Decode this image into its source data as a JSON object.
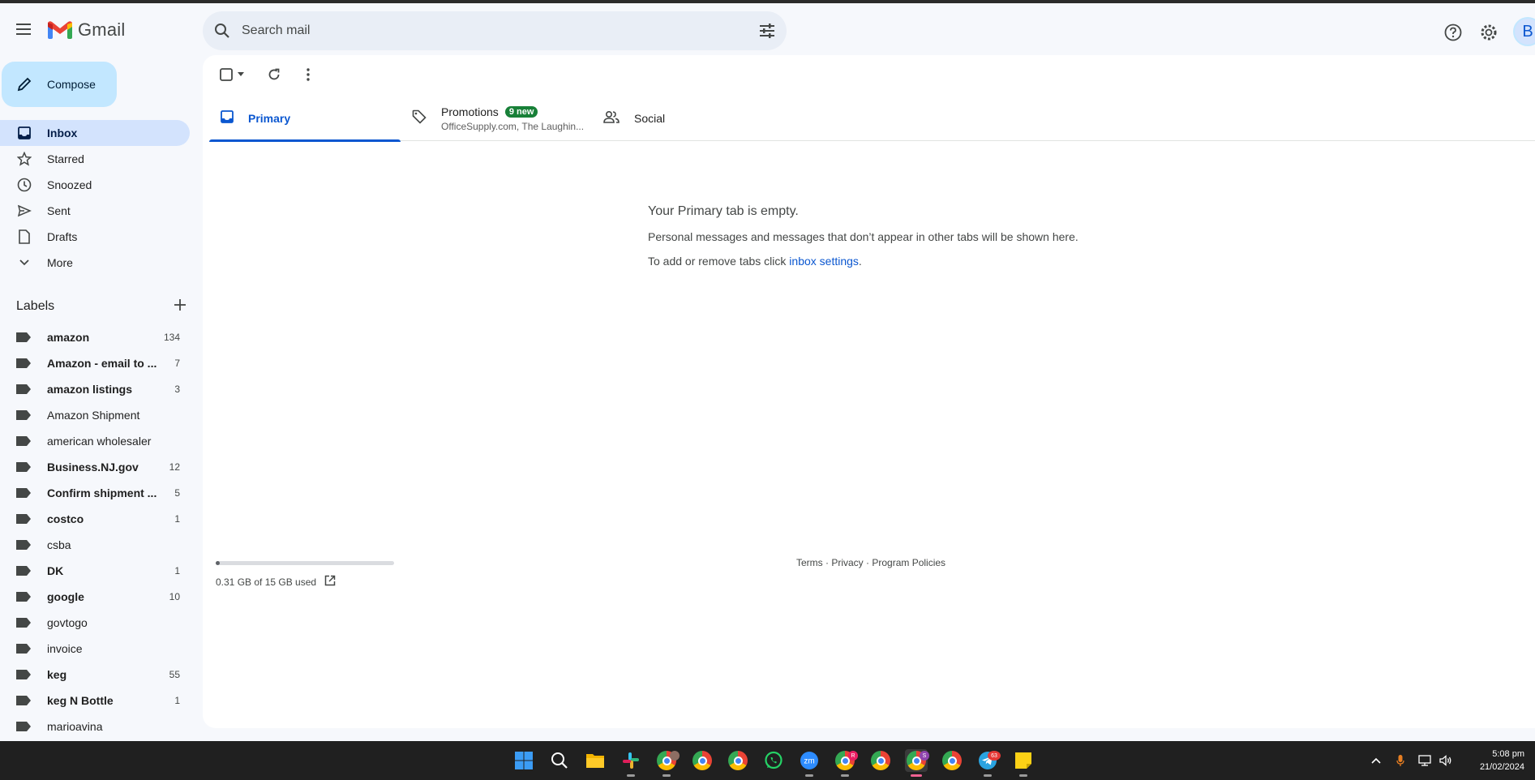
{
  "app": {
    "name": "Gmail"
  },
  "search": {
    "placeholder": "Search mail"
  },
  "compose": {
    "label": "Compose"
  },
  "nav": [
    {
      "label": "Inbox",
      "icon": "inbox-icon",
      "active": true
    },
    {
      "label": "Starred",
      "icon": "star-icon",
      "active": false
    },
    {
      "label": "Snoozed",
      "icon": "clock-icon",
      "active": false
    },
    {
      "label": "Sent",
      "icon": "send-icon",
      "active": false
    },
    {
      "label": "Drafts",
      "icon": "draft-icon",
      "active": false
    },
    {
      "label": "More",
      "icon": "chevron-down-icon",
      "active": false
    }
  ],
  "labels_header": "Labels",
  "labels": [
    {
      "name": "amazon",
      "count": "134",
      "bold": true
    },
    {
      "name": "Amazon - email to ...",
      "count": "7",
      "bold": true
    },
    {
      "name": "amazon listings",
      "count": "3",
      "bold": true
    },
    {
      "name": "Amazon Shipment",
      "count": "",
      "bold": false
    },
    {
      "name": "american wholesaler",
      "count": "",
      "bold": false
    },
    {
      "name": "Business.NJ.gov",
      "count": "12",
      "bold": true
    },
    {
      "name": "Confirm shipment ...",
      "count": "5",
      "bold": true
    },
    {
      "name": "costco",
      "count": "1",
      "bold": true
    },
    {
      "name": "csba",
      "count": "",
      "bold": false
    },
    {
      "name": "DK",
      "count": "1",
      "bold": true
    },
    {
      "name": "google",
      "count": "10",
      "bold": true
    },
    {
      "name": "govtogo",
      "count": "",
      "bold": false
    },
    {
      "name": "invoice",
      "count": "",
      "bold": false
    },
    {
      "name": "keg",
      "count": "55",
      "bold": true
    },
    {
      "name": "keg N Bottle",
      "count": "1",
      "bold": true
    },
    {
      "name": "marioavina",
      "count": "",
      "bold": false
    }
  ],
  "tabs": {
    "primary": "Primary",
    "promotions": "Promotions",
    "promotions_badge": "9 new",
    "promotions_sub": "OfficeSupply.com, The Laughin...",
    "social": "Social"
  },
  "empty_state": {
    "title": "Your Primary tab is empty.",
    "line1": "Personal messages and messages that don’t appear in other tabs will be shown here.",
    "line2_prefix": "To add or remove tabs click ",
    "line2_link": "inbox settings",
    "line2_suffix": "."
  },
  "storage": {
    "text": "0.31 GB of 15 GB used",
    "used_fraction": 0.021
  },
  "footer": {
    "terms": "Terms",
    "sep": " · ",
    "privacy": "Privacy",
    "policies": "Program Policies"
  },
  "avatar": {
    "initial": "B"
  },
  "taskbar": {
    "badges": {
      "chrome_r": "R",
      "chrome_s": "S",
      "telegram": "63"
    },
    "time": "5:08 pm",
    "date": "21/02/2024"
  },
  "colors": {
    "accent": "#0b57d0",
    "compose_bg": "#c2e7ff",
    "active_nav": "#d3e3fd",
    "badge_green": "#188038"
  }
}
